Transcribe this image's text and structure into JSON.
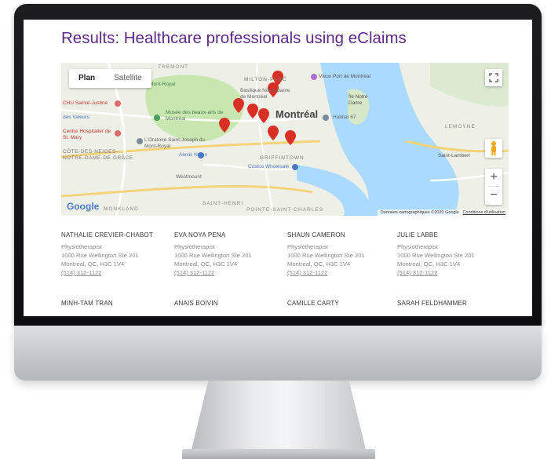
{
  "page": {
    "title": "Results: Healthcare professionals using eClaims"
  },
  "map": {
    "type_buttons": {
      "plan": "Plan",
      "satellite": "Satellite"
    },
    "zoom_in": "+",
    "zoom_out": "−",
    "logo": "Google",
    "attribution": "Données cartographiques ©2020 Google",
    "terms": "Conditions d'utilisation",
    "labels": {
      "city": "Montréal",
      "vieux_port": "Vieux Port de Montréal",
      "milton_parc": "MILTON-PARC",
      "basilique": "Basilique Notre-Dame de Montréal",
      "habitat": "Habitat 67",
      "musee": "Musée des beaux-arts de Montréal",
      "ste_justine": "CHU Sainte-Justine",
      "des_valeurs": "des Valeurs",
      "centre_hosp": "Centre Hospitalier de St. Mary",
      "oratoire": "L'Oratoire Saint-Joseph du Mont-Royal",
      "cote_des_neiges": "CÔTE-DES-NEIGES–NOTRE-DAME-DE-GRÂCE",
      "alexis_nihon": "Alexis Nihon",
      "westmount": "Westmount",
      "griffintown": "GRIFFINTOWN",
      "costco": "Costco Wholesale",
      "saint_henri": "SAINT-HENRI",
      "pointe_st_charles": "POINTE-SAINT-CHARLES",
      "monkland": "MONKLAND",
      "ile_notre_dame": "Île Notre Dame",
      "saint_lambert": "Saint-Lambert",
      "lemoyne": "LEMOYNE",
      "mont_royal": "Mont-Royal",
      "tremont": "TREMONT"
    }
  },
  "results": [
    {
      "name": "NATHALIE CREVIER-CHABOT",
      "profession": "Physiotherapist",
      "address1": "1000 Rue Wellington Ste 201",
      "address2": "Montreal, QC, H3C 1V4",
      "phone": "(514) 312-1122"
    },
    {
      "name": "EVA NOYA PENA",
      "profession": "Physiotherapist",
      "address1": "1000 Rue Wellington Ste 201",
      "address2": "Montreal, QC, H3C 1V4",
      "phone": "(514) 312-1122"
    },
    {
      "name": "SHAUN CAMERON",
      "profession": "Physiotherapist",
      "address1": "1000 Rue Wellington Ste 201",
      "address2": "Montreal, QC, H3C 1V4",
      "phone": "(514) 312-1122"
    },
    {
      "name": "JULIE LABBE",
      "profession": "Physiotherapist",
      "address1": "1000 Rue Wellington Ste 201",
      "address2": "Montreal, QC, H3C 1V4",
      "phone": "(514) 312-1122"
    },
    {
      "name": "MINH-TAM TRAN"
    },
    {
      "name": "ANAIS BOIVIN"
    },
    {
      "name": "CAMILLE CARTY"
    },
    {
      "name": "SARAH FELDHAMMER"
    }
  ],
  "colors": {
    "title": "#5b2a86",
    "pin": "#d93025",
    "water": "#aadaff",
    "park": "#c8e6b0"
  }
}
